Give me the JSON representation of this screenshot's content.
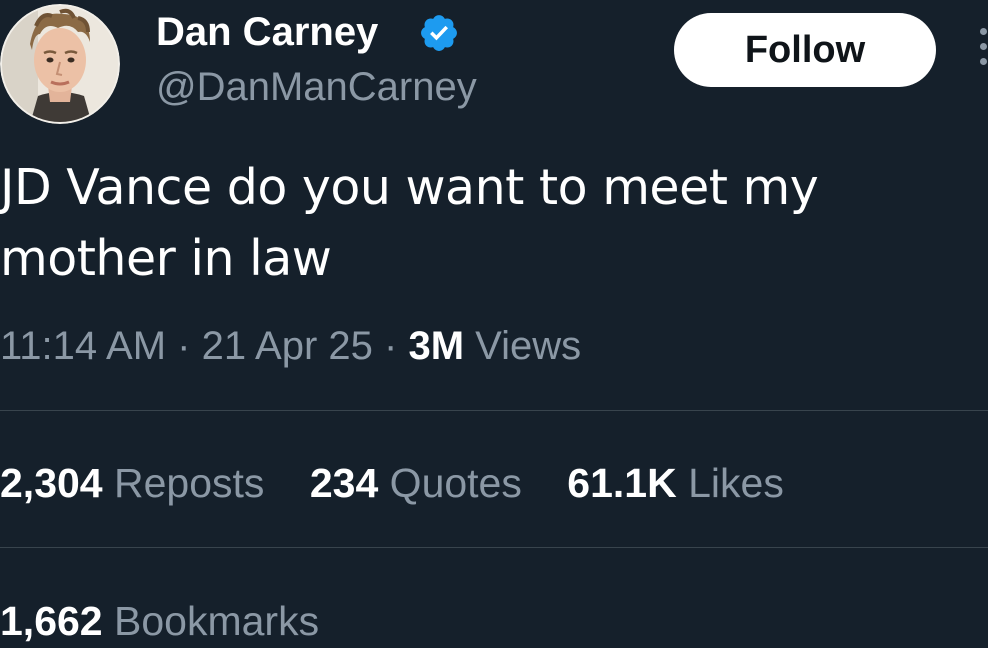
{
  "author": {
    "display_name": "Dan Carney",
    "handle": "@DanManCarney",
    "verified": true,
    "avatar_icon": "profile-photo",
    "verified_icon": "verified-badge-icon"
  },
  "follow_button": {
    "label": "Follow"
  },
  "more_icon": "more-options-icon",
  "tweet": {
    "text": "JD Vance do you want to meet my mother in law",
    "time": "11:14 AM",
    "date": "21 Apr 25",
    "separator": "·",
    "views_count": "3M",
    "views_label": "Views"
  },
  "stats": {
    "reposts": {
      "count": "2,304",
      "label": "Reposts"
    },
    "quotes": {
      "count": "234",
      "label": "Quotes"
    },
    "likes": {
      "count": "61.1K",
      "label": "Likes"
    },
    "bookmarks": {
      "count": "1,662",
      "label": "Bookmarks"
    }
  },
  "colors": {
    "background": "#15202b",
    "text_primary": "#ffffff",
    "text_secondary": "#8b98a5",
    "verified_blue": "#1d9bf0",
    "divider": "#38444d",
    "button_bg": "#ffffff",
    "button_text": "#0f1419"
  }
}
